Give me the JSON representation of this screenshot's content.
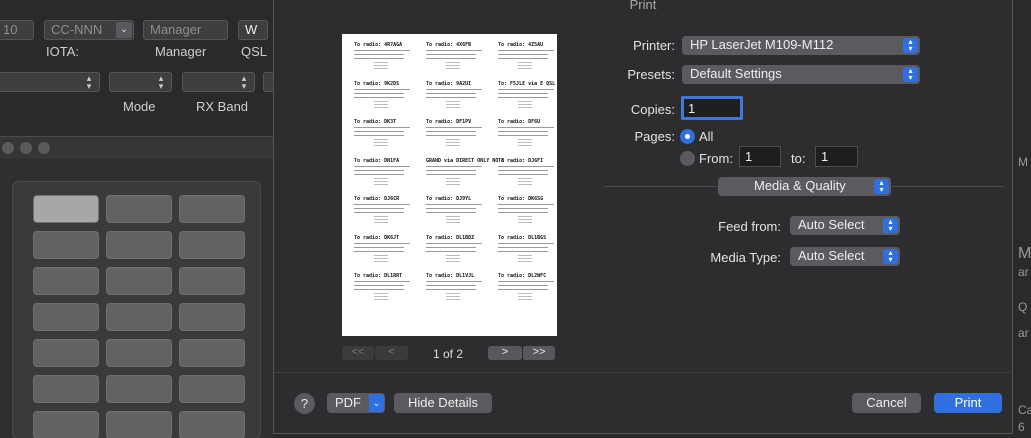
{
  "background_app": {
    "top_fields": {
      "number_partial": "10",
      "cc_field": "CC-NNN",
      "manager_field": "Manager",
      "w_field": "W"
    },
    "labels": {
      "iota": "IOTA:",
      "manager": "Manager",
      "qsl": "QSL",
      "mode": "Mode",
      "rx_band": "RX Band"
    },
    "right_edge_text": [
      "M",
      "ar",
      "Q",
      "ar",
      "Ca",
      "6"
    ]
  },
  "dialog": {
    "title": "Print",
    "preview": {
      "page_indicator": "1 of 2",
      "labels": [
        "To radio: 4R7AGA",
        "To radio: 4X6FB",
        "To radio: 4Z5AU",
        "To radio: 9K2DS",
        "To radio: 9A2UI",
        "To: F5JLE via E QSL",
        "To radio: DK3T",
        "To radio: DF1PV",
        "To radio: DF6U",
        "To radio: DN1FA",
        "GRAND via DIRECT ONLY NO E",
        "To radio: DJ6FI",
        "To radio: DJ6CR",
        "To radio: DJ9YL",
        "To radio: DK6SG",
        "To radio: DK6JT",
        "To radio: DL1BDZ",
        "To radio: DL1BGS",
        "To radio: DL1RRT",
        "To radio: DL1VJL",
        "To radio: DL2WFC"
      ]
    },
    "printer": {
      "label": "Printer:",
      "value": "HP LaserJet M109-M112"
    },
    "presets": {
      "label": "Presets:",
      "value": "Default Settings"
    },
    "copies": {
      "label": "Copies:",
      "value": "1"
    },
    "pages": {
      "label": "Pages:",
      "all_label": "All",
      "from_label": "From:",
      "from_value": "1",
      "to_label": "to:",
      "to_value": "1",
      "selected": "All"
    },
    "section_popup": "Media & Quality",
    "feed_from": {
      "label": "Feed from:",
      "value": "Auto Select"
    },
    "media_type": {
      "label": "Media Type:",
      "value": "Auto Select"
    },
    "buttons": {
      "help": "?",
      "pdf": "PDF",
      "hide_details": "Hide Details",
      "cancel": "Cancel",
      "print": "Print"
    },
    "colors": {
      "accent": "#2f6fe0",
      "dialog_bg": "#2d2d2f",
      "button_bg": "#5b5b5f"
    }
  }
}
